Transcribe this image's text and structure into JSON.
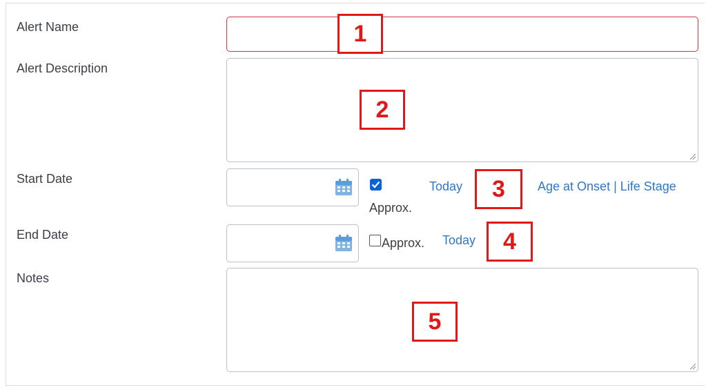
{
  "fields": {
    "alert_name": {
      "label": "Alert Name",
      "value": ""
    },
    "alert_description": {
      "label": "Alert Description",
      "value": ""
    },
    "start_date": {
      "label": "Start Date",
      "value": "",
      "approx_checked": true,
      "approx_label": "Approx.",
      "today_link": "Today",
      "age_link": "Age at Onset | Life Stage"
    },
    "end_date": {
      "label": "End Date",
      "value": "",
      "approx_checked": false,
      "approx_label": "Approx.",
      "today_link": "Today"
    },
    "notes": {
      "label": "Notes",
      "value": ""
    }
  },
  "annotations": [
    "1",
    "2",
    "3",
    "4",
    "5"
  ],
  "colors": {
    "error_border": "#d5343b",
    "link": "#2f77c7",
    "callout": "#e01818",
    "checkbox": "#0a63d6"
  },
  "icons": {
    "calendar": "calendar-icon",
    "resize": "resize-handle-icon"
  }
}
